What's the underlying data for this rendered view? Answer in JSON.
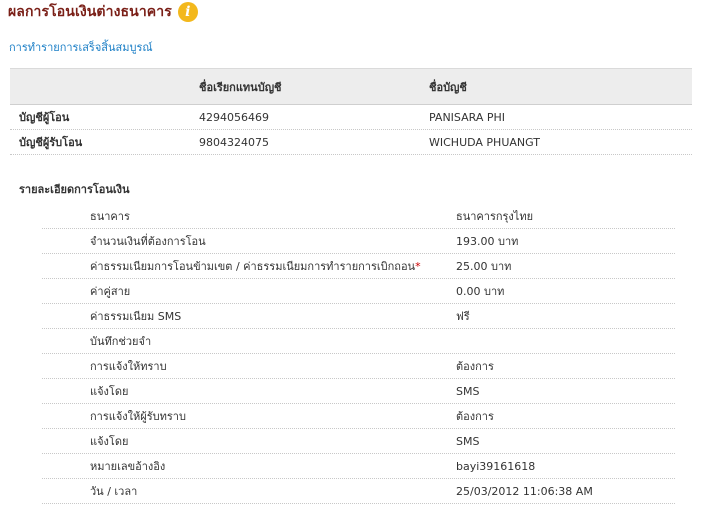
{
  "header": {
    "title": "ผลการโอนเงินต่างธนาคาร",
    "info_glyph": "i"
  },
  "status": "การทำรายการเสร็จสิ้นสมบูรณ์",
  "accounts": {
    "columns": [
      "",
      "ชื่อเรียกแทนบัญชี",
      "ชื่อบัญชี"
    ],
    "rows": [
      {
        "label": "บัญชีผู้โอน",
        "number": "4294056469",
        "name": "PANISARA PHI"
      },
      {
        "label": "บัญชีผู้รับโอน",
        "number": "9804324075",
        "name": "WICHUDA PHUANGT"
      }
    ]
  },
  "details": {
    "title": "รายละเอียดการโอนเงิน",
    "rows": [
      {
        "label": "ธนาคาร",
        "value": "ธนาคารกรุงไทย"
      },
      {
        "label": "จำนวนเงินที่ต้องการโอน",
        "value": "193.00 บาท"
      },
      {
        "label": "ค่าธรรมเนียมการโอนข้ามเขต / ค่าธรรมเนียมการทำรายการเบิกถอน",
        "required_mark": "*",
        "value": "25.00 บาท"
      },
      {
        "label": "ค่าคู่สาย",
        "value": "0.00 บาท"
      },
      {
        "label": "ค่าธรรมเนียม SMS",
        "value": "ฟรี"
      },
      {
        "label": "บันทึกช่วยจำ",
        "value": ""
      },
      {
        "label": "การแจ้งให้ทราบ",
        "value": "ต้องการ"
      },
      {
        "label": "แจ้งโดย",
        "value": "SMS"
      },
      {
        "label": "การแจ้งให้ผู้รับทราบ",
        "value": "ต้องการ"
      },
      {
        "label": "แจ้งโดย",
        "value": "SMS"
      },
      {
        "label": "หมายเลขอ้างอิง",
        "value": "bayi39161618"
      },
      {
        "label": "วัน / เวลา",
        "value": "25/03/2012 11:06:38 AM"
      }
    ]
  },
  "colors": {
    "title": "#7a1f17",
    "status": "#1c7fc6",
    "info_icon": "#f3b81c",
    "header_bg": "#ededed",
    "required": "#cc0000"
  },
  "icons": {
    "info": "info-icon"
  }
}
